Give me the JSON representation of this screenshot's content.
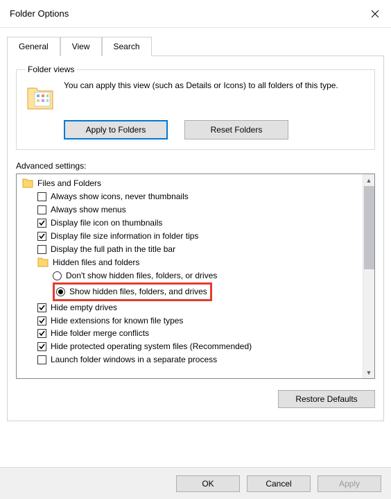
{
  "window": {
    "title": "Folder Options"
  },
  "tabs": {
    "general": "General",
    "view": "View",
    "search": "Search"
  },
  "folder_views": {
    "legend": "Folder views",
    "text": "You can apply this view (such as Details or Icons) to all folders of this type.",
    "apply": "Apply to Folders",
    "reset": "Reset Folders"
  },
  "advanced": {
    "label": "Advanced settings:",
    "group": "Files and Folders",
    "items": {
      "always_icons": "Always show icons, never thumbnails",
      "always_menus": "Always show menus",
      "icon_thumbs": "Display file icon on thumbnails",
      "size_tips": "Display file size information in folder tips",
      "full_path": "Display the full path in the title bar",
      "hidden_group": "Hidden files and folders",
      "dont_show_hidden": "Don't show hidden files, folders, or drives",
      "show_hidden": "Show hidden files, folders, and drives",
      "hide_empty": "Hide empty drives",
      "hide_ext": "Hide extensions for known file types",
      "hide_merge": "Hide folder merge conflicts",
      "hide_protected": "Hide protected operating system files (Recommended)",
      "launch_separate": "Launch folder windows in a separate process"
    }
  },
  "buttons": {
    "restore": "Restore Defaults",
    "ok": "OK",
    "cancel": "Cancel",
    "apply": "Apply"
  }
}
